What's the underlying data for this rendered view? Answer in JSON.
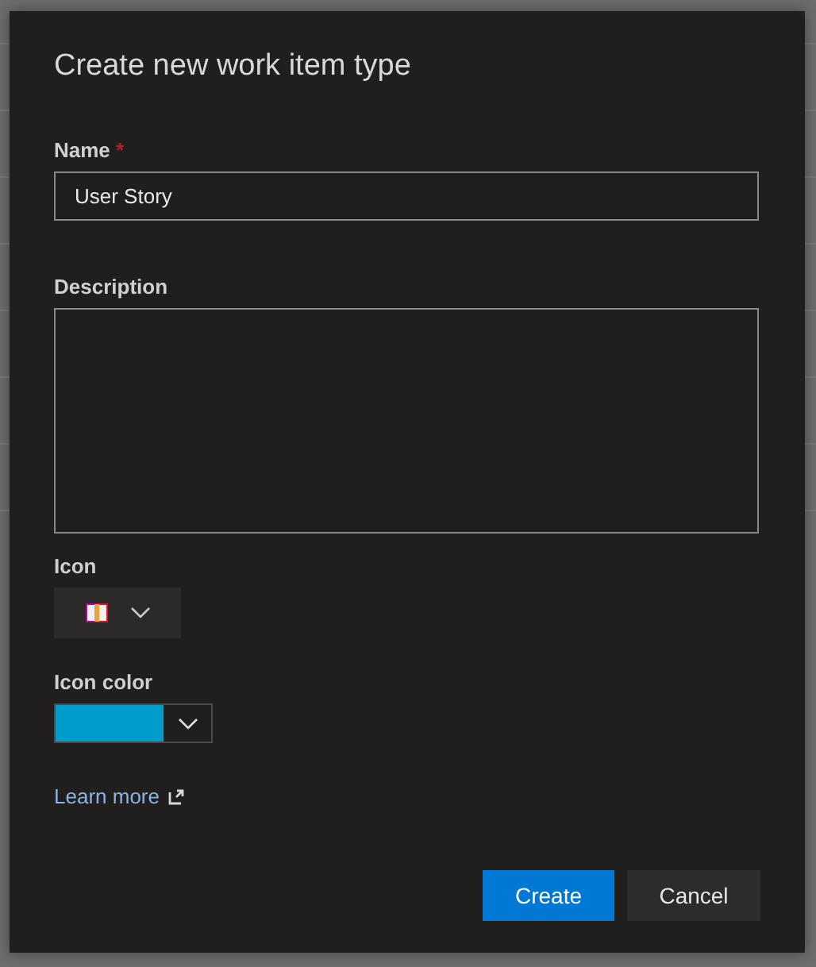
{
  "dialog": {
    "title": "Create new work item type",
    "name_field": {
      "label": "Name",
      "required_mark": "*",
      "value": "User Story"
    },
    "description_field": {
      "label": "Description"
    },
    "icon_field": {
      "label": "Icon"
    },
    "icon_color_field": {
      "label": "Icon color",
      "color": "#009ccc"
    },
    "learn_more": "Learn more",
    "buttons": [
      {
        "label": "Create",
        "kind": "primary"
      },
      {
        "label": "Cancel",
        "kind": "secondary"
      }
    ]
  }
}
